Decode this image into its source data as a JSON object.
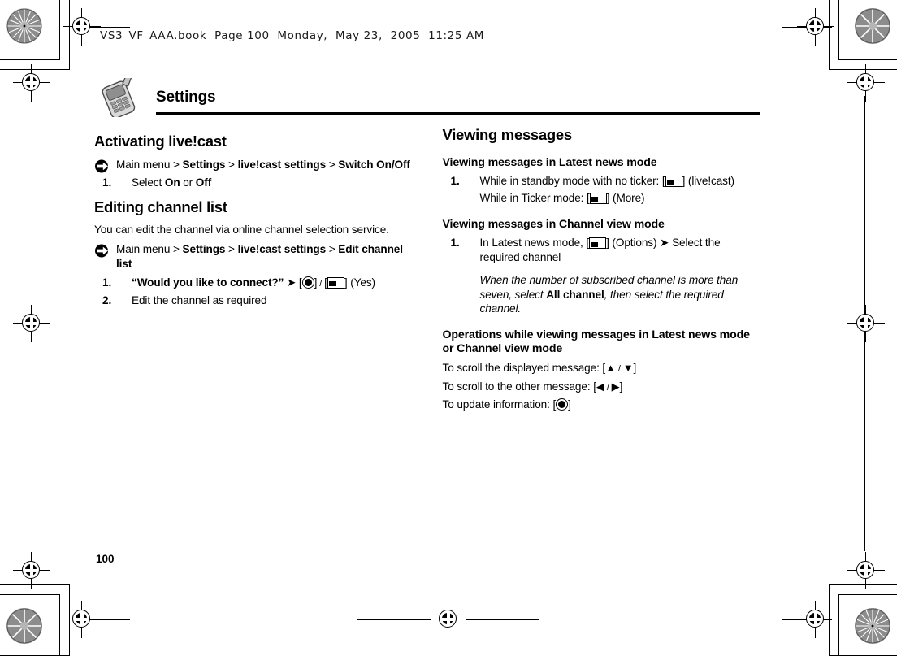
{
  "print": {
    "filename_line": "VS3_VF_AAA.book  Page 100  Monday,  May 23,  2005  11:25 AM",
    "page_number": "100"
  },
  "chapter": {
    "icon": "mobile-phone-icon",
    "title": "Settings"
  },
  "left_column": {
    "section1": {
      "heading": "Activating live!cast",
      "navpath": {
        "bullet_icon": "arrow-bullet-icon",
        "parts": [
          {
            "text": "Main menu",
            "bold": false
          },
          {
            "text": " > ",
            "bold": false
          },
          {
            "text": "Settings",
            "bold": true
          },
          {
            "text": " > ",
            "bold": false
          },
          {
            "text": "live!cast settings",
            "bold": true
          },
          {
            "text": " > ",
            "bold": false
          },
          {
            "text": "Switch On/Off",
            "bold": true
          }
        ],
        "plain": "Main menu > Settings > live!cast settings > Switch On/Off"
      },
      "steps": [
        {
          "num": "1.",
          "text": "Select On or Off"
        }
      ]
    },
    "section2": {
      "heading": "Editing channel list",
      "intro": "You can edit the channel via online channel selection service.",
      "navpath": {
        "bullet_icon": "arrow-bullet-icon",
        "plain": "Main menu > Settings > live!cast settings > Edit channel list"
      },
      "steps": [
        {
          "num": "1.",
          "text": "“Would you like to connect?” ➔ [center-key] / [softkey] (Yes)"
        },
        {
          "num": "2.",
          "text": "Edit the channel as required"
        }
      ]
    }
  },
  "right_column": {
    "section1": {
      "heading": "Viewing messages",
      "sub1": {
        "heading": "Viewing messages in Latest news mode",
        "steps": [
          {
            "num": "1.",
            "line1_pre": "While in standby mode with no ticker: [",
            "line1_post": "] (live!cast)",
            "line2_pre": "While in Ticker mode: [",
            "line2_post": "] (More)"
          }
        ]
      },
      "sub2": {
        "heading": "Viewing messages in Channel view mode",
        "steps": [
          {
            "num": "1.",
            "line_pre": "In Latest news mode, [",
            "line_mid": "] (Options) ➔ Select the required channel",
            "note_pre": "When the number of subscribed channel is more than seven, select ",
            "note_bold": "All channel",
            "note_post": ", then select the required channel."
          }
        ]
      },
      "sub3": {
        "heading": "Operations while viewing messages in Latest news mode or Channel view mode",
        "operations": [
          {
            "label": "To scroll the displayed message: [",
            "keys": "up-down-arrows",
            "suffix": "]"
          },
          {
            "label": "To scroll to the other message: [",
            "keys": "left-right-arrows",
            "suffix": "]"
          },
          {
            "label": "To update information: [",
            "keys": "center-key",
            "suffix": "]"
          }
        ]
      }
    }
  }
}
